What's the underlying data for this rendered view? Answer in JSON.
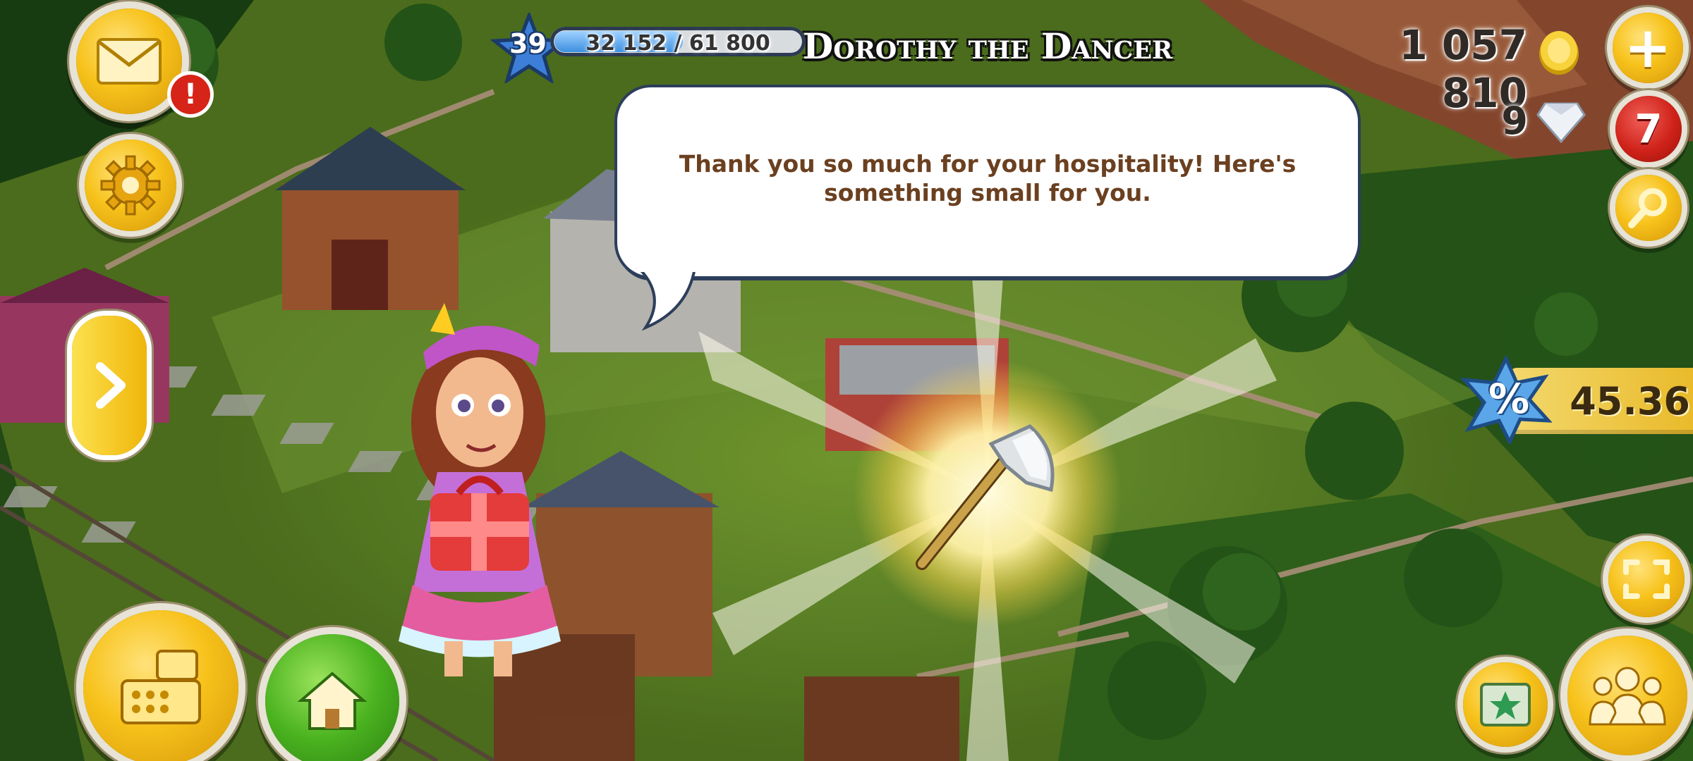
{
  "hud": {
    "level": "39",
    "xp_text": "32 152 / 61 800",
    "xp_fraction": 0.52,
    "coins": "1 057 810",
    "gems": "9",
    "shop_badge": "7",
    "mail_badge": "!",
    "discount_value": "45.36",
    "discount_symbol": "%"
  },
  "dialog": {
    "character_name": "Dorothy the Dancer",
    "message": "Thank you so much for your hospitality! Here's something small for you.",
    "reward_item_icon": "axe-icon"
  },
  "icons": {
    "mail": "envelope-icon",
    "settings": "gear-icon",
    "expand": "chevron-right-icon",
    "cash_register": "cash-register-icon",
    "home": "house-icon",
    "add_coins": "plus-icon",
    "search": "magnifier-icon",
    "zoom": "expand-arrows-icon",
    "album": "map-icon",
    "friends": "people-icon"
  },
  "colors": {
    "gold": "#f7c21b",
    "green": "#4ab21f",
    "red": "#cf2219",
    "bubble_text": "#6b4020"
  }
}
